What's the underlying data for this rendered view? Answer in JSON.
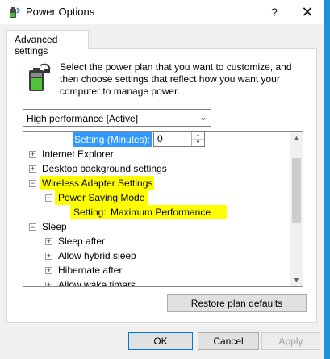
{
  "window": {
    "title": "Power Options",
    "help_button": "?",
    "close_button": "✕"
  },
  "tab": {
    "label": "Advanced settings"
  },
  "description": "Select the power plan that you want to customize, and then choose settings that reflect how you want your computer to manage power.",
  "plan_dropdown": {
    "value": "High performance [Active]"
  },
  "tree": {
    "setting_minutes_label": "Setting (Minutes):",
    "setting_minutes_value": "0",
    "items": [
      {
        "expander": "+",
        "label": "Internet Explorer"
      },
      {
        "expander": "+",
        "label": "Desktop background settings"
      },
      {
        "expander": "−",
        "label": "Wireless Adapter Settings"
      },
      {
        "expander": "−",
        "label": "Power Saving Mode"
      },
      {
        "setting_label": "Setting:",
        "setting_value": "Maximum Performance"
      },
      {
        "expander": "−",
        "label": "Sleep"
      },
      {
        "expander": "+",
        "label": "Sleep after"
      },
      {
        "expander": "+",
        "label": "Allow hybrid sleep"
      },
      {
        "expander": "+",
        "label": "Hibernate after"
      },
      {
        "expander": "+",
        "label": "Allow wake timers"
      }
    ]
  },
  "buttons": {
    "restore": "Restore plan defaults",
    "ok": "OK",
    "cancel": "Cancel",
    "apply": "Apply"
  },
  "colors": {
    "highlight": "#ffff00",
    "selection": "#3399ff",
    "desktop": "#1f8fd8"
  }
}
